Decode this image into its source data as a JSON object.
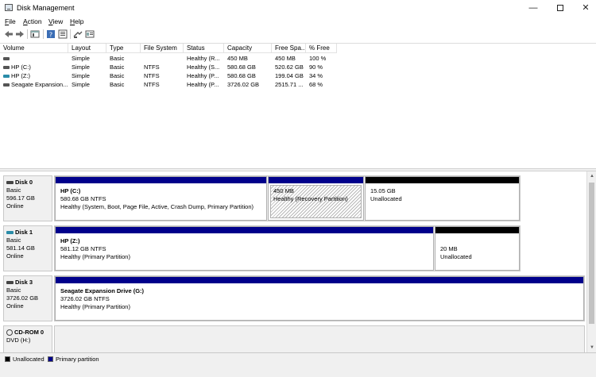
{
  "window": {
    "title": "Disk Management",
    "minimize": "—",
    "close": "✕"
  },
  "menu": [
    {
      "key": "F",
      "rest": "ile"
    },
    {
      "key": "A",
      "rest": "ction"
    },
    {
      "key": "V",
      "rest": "iew"
    },
    {
      "key": "H",
      "rest": "elp"
    }
  ],
  "columns": [
    "Volume",
    "Layout",
    "Type",
    "File System",
    "Status",
    "Capacity",
    "Free Spa...",
    "% Free"
  ],
  "volumes": [
    {
      "volume": "",
      "layout": "Simple",
      "type": "Basic",
      "fs": "",
      "status": "Healthy (R...",
      "capacity": "450 MB",
      "free": "450 MB",
      "pct": "100 %"
    },
    {
      "volume": "HP (C:)",
      "layout": "Simple",
      "type": "Basic",
      "fs": "NTFS",
      "status": "Healthy (S...",
      "capacity": "580.68 GB",
      "free": "520.62 GB",
      "pct": "90 %"
    },
    {
      "volume": "HP (Z:)",
      "layout": "Simple",
      "type": "Basic",
      "fs": "NTFS",
      "status": "Healthy (P...",
      "capacity": "580.68 GB",
      "free": "199.04 GB",
      "pct": "34 %"
    },
    {
      "volume": "Seagate Expansion...",
      "layout": "Simple",
      "type": "Basic",
      "fs": "NTFS",
      "status": "Healthy (P...",
      "capacity": "3726.02 GB",
      "free": "2515.71 ...",
      "pct": "68 %"
    }
  ],
  "disks": [
    {
      "name": "Disk 0",
      "type": "Basic",
      "size": "596.17 GB",
      "status": "Online",
      "partitions": [
        {
          "name": "HP  (C:)",
          "size": "580.68 GB NTFS",
          "status": "Healthy (System, Boot, Page File, Active, Crash Dump, Primary Partition)"
        },
        {
          "name": "",
          "size": "450 MB",
          "status": "Healthy (Recovery Partition)"
        },
        {
          "name": "",
          "size": "15.05 GB",
          "status": "Unallocated"
        }
      ]
    },
    {
      "name": "Disk 1",
      "type": "Basic",
      "size": "581.14 GB",
      "status": "Online",
      "partitions": [
        {
          "name": "HP  (Z:)",
          "size": "581.12 GB NTFS",
          "status": "Healthy (Primary Partition)"
        },
        {
          "name": "",
          "size": "20 MB",
          "status": "Unallocated"
        }
      ]
    },
    {
      "name": "Disk 3",
      "type": "Basic",
      "size": "3726.02 GB",
      "status": "Online",
      "partitions": [
        {
          "name": "Seagate Expansion Drive  (G:)",
          "size": "3726.02 GB NTFS",
          "status": "Healthy (Primary Partition)"
        }
      ]
    },
    {
      "name": "CD-ROM 0",
      "type": "DVD (H:)",
      "size": "",
      "status": ""
    }
  ],
  "legend": {
    "unallocated": "Unallocated",
    "primary": "Primary partition"
  },
  "colors": {
    "primary": "#00008b",
    "unallocated": "#000000"
  }
}
